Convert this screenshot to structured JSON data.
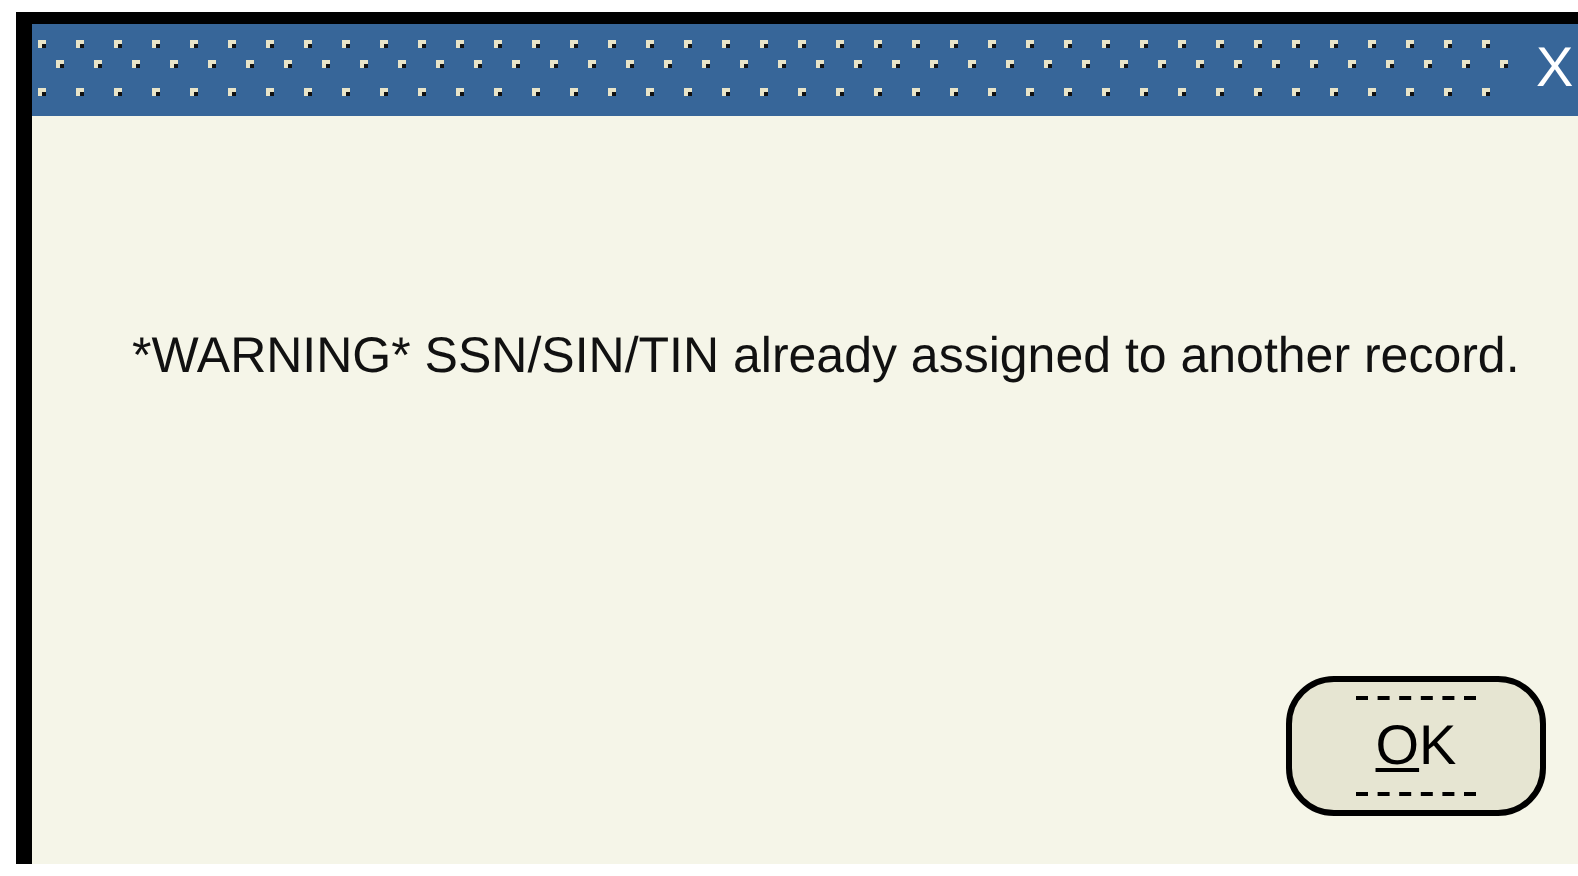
{
  "window": {
    "close_button": "X"
  },
  "message": "*WARNING* SSN/SIN/TIN already assigned to another record.",
  "buttons": [
    {
      "label": "OK",
      "focused": true
    }
  ]
}
